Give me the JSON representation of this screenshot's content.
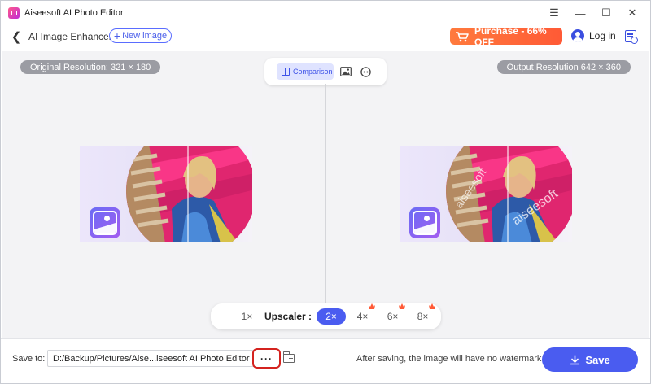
{
  "window": {
    "title": "Aiseesoft AI Photo Editor",
    "controls": {
      "menu": "☰",
      "minimize": "—",
      "maximize": "☐",
      "close": "✕"
    }
  },
  "header": {
    "page_title": "AI Image Enhancer",
    "new_image_label": "New image",
    "purchase_label": "Purchase - 66% OFF",
    "login_label": "Log in"
  },
  "workspace": {
    "original_resolution": "Original Resolution: 321 × 180",
    "output_resolution": "Output Resolution 642 × 360",
    "view_mode_label": "Comparison",
    "watermark_text": "aiseesoft"
  },
  "upscaler": {
    "label": "Upscaler :",
    "options": [
      "1×",
      "2×",
      "4×",
      "6×",
      "8×"
    ],
    "selected": "2×"
  },
  "footer": {
    "save_to_label": "Save to:",
    "save_path": "D:/Backup/Pictures/Aise...iseesoft AI Photo Editor",
    "more_label": "···",
    "note": "After saving, the image will have no watermark.",
    "save_label": "Save"
  },
  "colors": {
    "accent": "#4a5cf0",
    "purchase": "#ff6a3a",
    "highlight_border": "#d4231f"
  }
}
